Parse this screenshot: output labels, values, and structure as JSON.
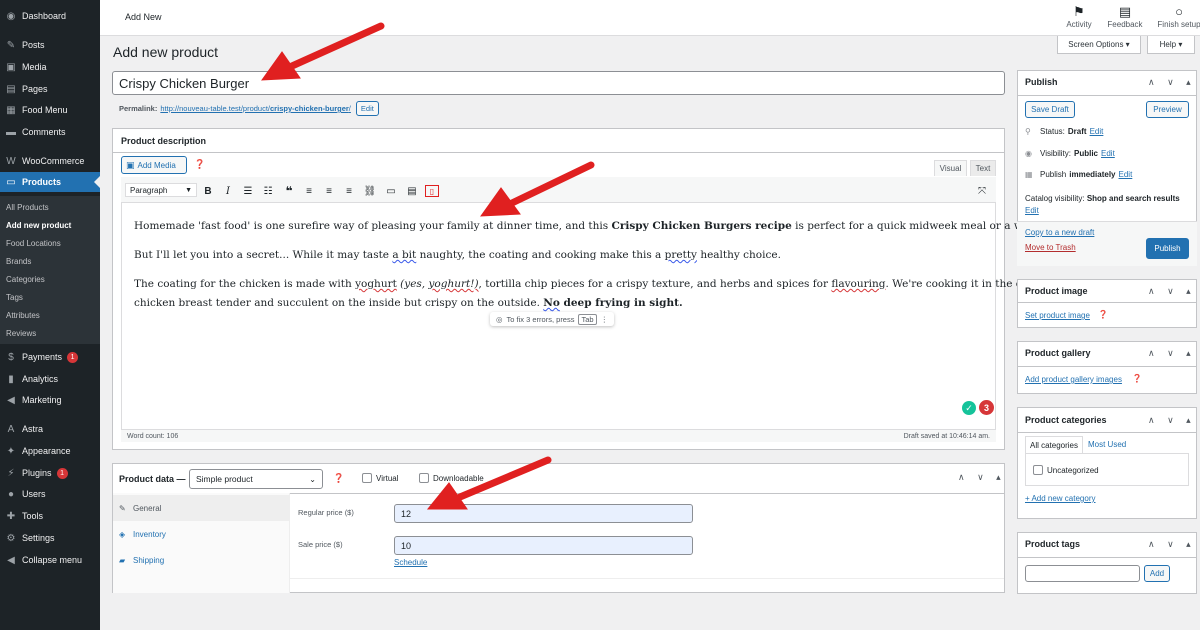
{
  "sidebar": {
    "items": [
      {
        "label": "Dashboard",
        "icon": "dashboard-icon",
        "glyph": "◉"
      },
      {
        "label": "Posts",
        "icon": "pin-icon",
        "glyph": "✎"
      },
      {
        "label": "Media",
        "icon": "media-icon",
        "glyph": "▣"
      },
      {
        "label": "Pages",
        "icon": "pages-icon",
        "glyph": "▤"
      },
      {
        "label": "Food Menu",
        "icon": "food-menu-icon",
        "glyph": "▦"
      },
      {
        "label": "Comments",
        "icon": "comments-icon",
        "glyph": "▬"
      },
      {
        "label": "WooCommerce",
        "icon": "woocommerce-icon",
        "glyph": "W"
      },
      {
        "label": "Products",
        "icon": "products-icon",
        "glyph": "▭"
      }
    ],
    "submenu": [
      "All Products",
      "Add new product",
      "Food Locations",
      "Brands",
      "Categories",
      "Tags",
      "Attributes",
      "Reviews"
    ],
    "items2": [
      {
        "label": "Payments",
        "icon": "payments-icon",
        "glyph": "$",
        "badge": "1"
      },
      {
        "label": "Analytics",
        "icon": "analytics-icon",
        "glyph": "▮"
      },
      {
        "label": "Marketing",
        "icon": "marketing-icon",
        "glyph": "◀"
      },
      {
        "label": "Astra",
        "icon": "astra-icon",
        "glyph": "A"
      },
      {
        "label": "Appearance",
        "icon": "appearance-icon",
        "glyph": "✦"
      },
      {
        "label": "Plugins",
        "icon": "plugins-icon",
        "glyph": "⚡",
        "badge": "1"
      },
      {
        "label": "Users",
        "icon": "users-icon",
        "glyph": "●"
      },
      {
        "label": "Tools",
        "icon": "tools-icon",
        "glyph": "✚"
      },
      {
        "label": "Settings",
        "icon": "settings-icon",
        "glyph": "⚙"
      },
      {
        "label": "Collapse menu",
        "icon": "collapse-icon",
        "glyph": "◀"
      }
    ]
  },
  "topbar": {
    "title": "Add New",
    "actions": [
      {
        "label": "Activity",
        "glyph": "⚑"
      },
      {
        "label": "Feedback",
        "glyph": "▤"
      },
      {
        "label": "Finish setup",
        "glyph": "○"
      }
    ],
    "screen_options": "Screen Options ▾",
    "help": "Help ▾"
  },
  "page": {
    "heading": "Add new product",
    "product_title": "Crispy Chicken Burger",
    "permalink_label": "Permalink:",
    "permalink_base": "http://nouveau-table.test/product/",
    "permalink_slug": "crispy-chicken-burger",
    "permalink_end": "/",
    "edit_label": "Edit"
  },
  "description": {
    "title": "Product description",
    "add_media": "Add Media",
    "visual_tab": "Visual",
    "text_tab": "Text",
    "paragraph_select": "Paragraph",
    "p1_before": "Homemade 'fast food' is one surefire way of pleasing your family at dinner time, and this ",
    "p1_bold": "Crispy Chicken Burgers recipe",
    "p1_after": " is perfect for a quick midweek meal or a weekend treat.",
    "p2_a": "But I'll let you into a secret... While it may taste ",
    "p2_b": "a bit",
    "p2_c": " naughty, the coating and cooking make this a ",
    "p2_d": "pretty",
    "p2_e": " healthy choice.",
    "p3_a": "The coating for the chicken is made with ",
    "p3_b": "yoghurt",
    "p3_c": " ",
    "p3_d": "(yes, ",
    "p3_e": "yoghurt!)",
    "p3_f": ", tortilla chip pieces for a crispy texture, and herbs and spices for ",
    "p3_g": "flavouring",
    "p3_h": ". We're cooking it in the oven to keep that",
    "p4_a": "chicken breast tender and succulent on the inside but crispy on the outside. ",
    "p4_b": "No",
    "p4_c": " deep frying in sight.",
    "grammar_hint": "To fix 3 errors, press",
    "grammar_key": "Tab",
    "grammar_count": "3",
    "word_count": "Word count: 106",
    "draft_saved": "Draft saved at 10:46:14 am."
  },
  "product_data": {
    "title": "Product data —",
    "type": "Simple product",
    "virtual": "Virtual",
    "downloadable": "Downloadable",
    "tabs": [
      "General",
      "Inventory",
      "Shipping"
    ],
    "regular_price_label": "Regular price ($)",
    "regular_price": "12",
    "sale_price_label": "Sale price ($)",
    "sale_price": "10",
    "schedule": "Schedule"
  },
  "publish": {
    "title": "Publish",
    "save_draft": "Save Draft",
    "preview": "Preview",
    "status_label": "Status:",
    "status_value": "Draft",
    "visibility_label": "Visibility:",
    "visibility_value": "Public",
    "publish_label": "Publish",
    "publish_value": "immediately",
    "catalog_label": "Catalog visibility:",
    "catalog_value": "Shop and search results",
    "edit": "Edit",
    "copy_draft": "Copy to a new draft",
    "trash": "Move to Trash",
    "publish_btn": "Publish"
  },
  "product_image": {
    "title": "Product image",
    "link": "Set product image"
  },
  "product_gallery": {
    "title": "Product gallery",
    "link": "Add product gallery images"
  },
  "product_categories": {
    "title": "Product categories",
    "tab_all": "All categories",
    "tab_most": "Most Used",
    "uncategorized": "Uncategorized",
    "add_new": "+ Add new category"
  },
  "product_tags": {
    "title": "Product tags",
    "add": "Add"
  },
  "handles": "∧ ∨ ▴",
  "colors": {
    "admin_sidebar": "#1d2327",
    "accent": "#2271b1",
    "arrow": "#e02020",
    "error": "#d63638"
  }
}
